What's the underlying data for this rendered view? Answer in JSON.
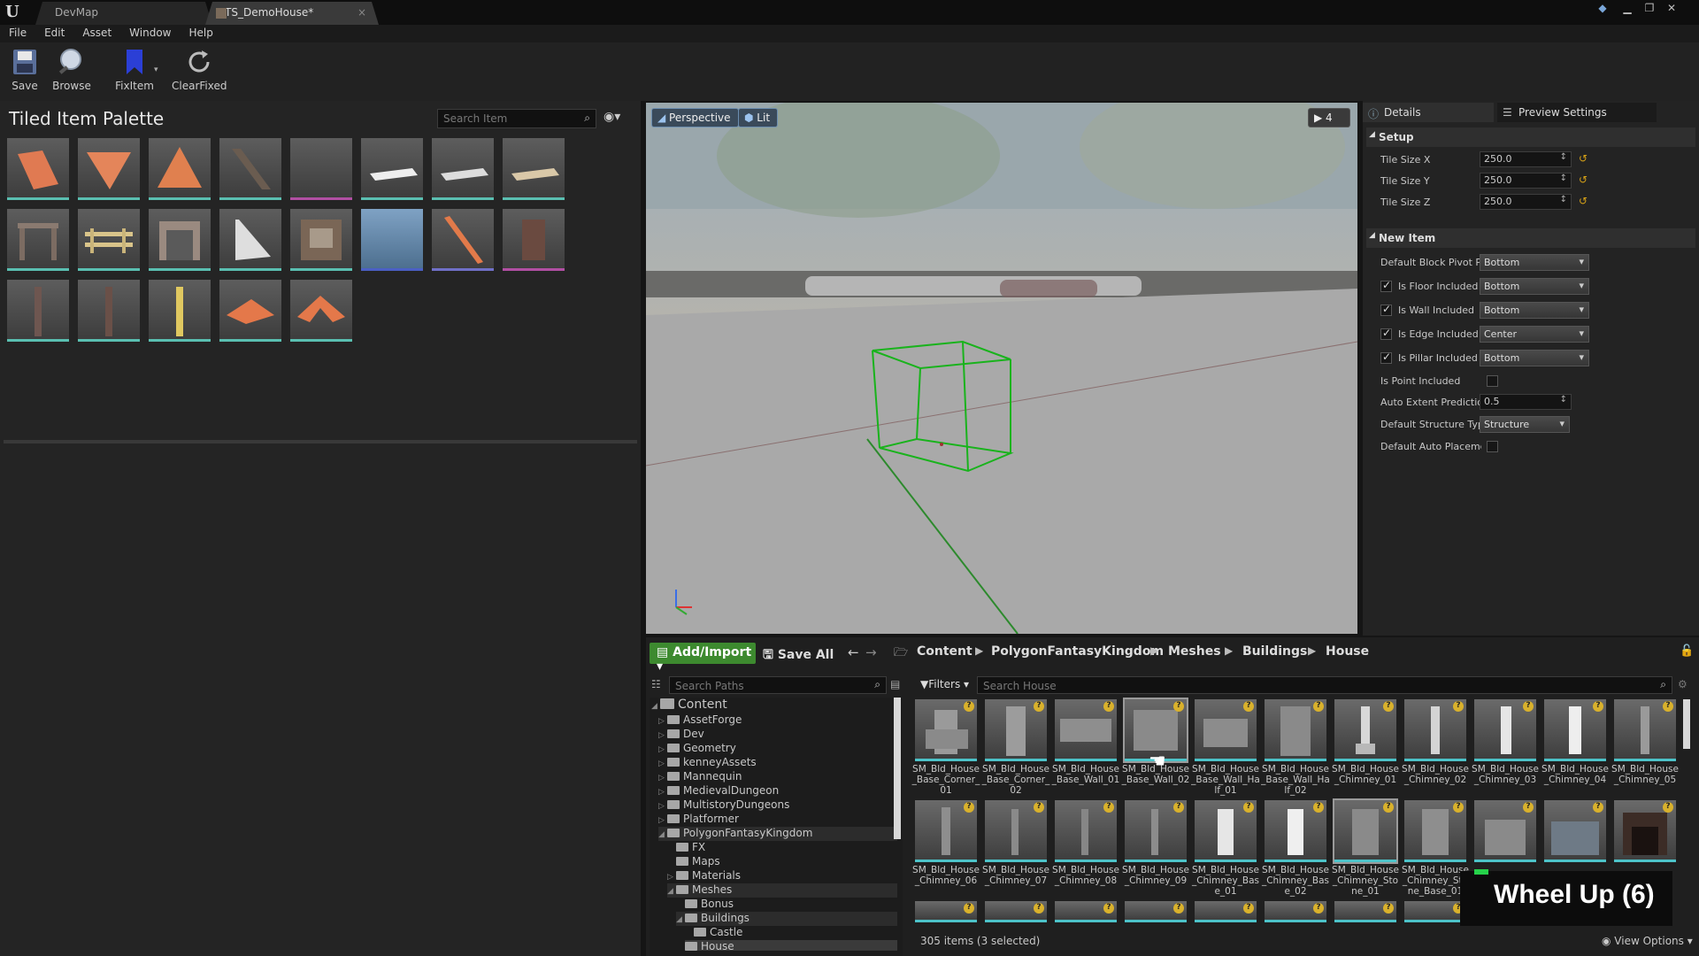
{
  "window": {
    "tabs": [
      {
        "label": "DevMap"
      },
      {
        "label": "TS_DemoHouse*"
      }
    ],
    "controls": [
      "minimize",
      "restore",
      "close"
    ]
  },
  "menu": [
    "File",
    "Edit",
    "Asset",
    "Window",
    "Help"
  ],
  "toolbar": {
    "save": "Save",
    "browse": "Browse",
    "fixitem": "FixItem",
    "clearfixed": "ClearFixed"
  },
  "palette": {
    "title": "Tiled Item Palette",
    "search_placeholder": "Search Item",
    "items_count": 21
  },
  "viewport": {
    "perspective": "Perspective",
    "lit": "Lit",
    "camera_speed": "4"
  },
  "details": {
    "tab_details": "Details",
    "tab_preview": "Preview Settings",
    "setup_label": "Setup",
    "tile_size_x_label": "Tile Size X",
    "tile_size_x": "250.0",
    "tile_size_y_label": "Tile Size Y",
    "tile_size_y": "250.0",
    "tile_size_z_label": "Tile Size Z",
    "tile_size_z": "250.0",
    "new_item_label": "New Item",
    "default_block_pivot_label": "Default Block Pivot P",
    "default_block_pivot": "Bottom",
    "floor_label": "Is Floor Included",
    "floor_value": "Bottom",
    "wall_label": "Is Wall Included",
    "wall_value": "Bottom",
    "edge_label": "Is Edge Included",
    "edge_value": "Center",
    "pillar_label": "Is Pillar Included",
    "pillar_value": "Bottom",
    "point_label": "Is Point Included",
    "auto_extent_label": "Auto Extent Prediction",
    "auto_extent": "0.5",
    "structure_type_label": "Default Structure Typ",
    "structure_type": "Structure",
    "auto_placement_label": "Default Auto Placeme"
  },
  "content_browser": {
    "add_import": "Add/Import",
    "save_all": "Save All",
    "breadcrumb": [
      "Content",
      "PolygonFantasyKingdom",
      "Meshes",
      "Buildings",
      "House"
    ],
    "search_paths_placeholder": "Search Paths",
    "filters": "Filters",
    "search_placeholder": "Search House",
    "status": "305 items (3 selected)",
    "view_options": "View Options",
    "tree": [
      {
        "label": "Content",
        "depth": 0,
        "expanded": true
      },
      {
        "label": "AssetForge",
        "depth": 1
      },
      {
        "label": "Dev",
        "depth": 1
      },
      {
        "label": "Geometry",
        "depth": 1
      },
      {
        "label": "kenneyAssets",
        "depth": 1
      },
      {
        "label": "Mannequin",
        "depth": 1
      },
      {
        "label": "MedievalDungeon",
        "depth": 1
      },
      {
        "label": "MultistoryDungeons",
        "depth": 1
      },
      {
        "label": "Platformer",
        "depth": 1
      },
      {
        "label": "PolygonFantasyKingdom",
        "depth": 1,
        "expanded": true
      },
      {
        "label": "FX",
        "depth": 2
      },
      {
        "label": "Maps",
        "depth": 2
      },
      {
        "label": "Materials",
        "depth": 2
      },
      {
        "label": "Meshes",
        "depth": 2,
        "expanded": true
      },
      {
        "label": "Bonus",
        "depth": 3
      },
      {
        "label": "Buildings",
        "depth": 3,
        "expanded": true
      },
      {
        "label": "Castle",
        "depth": 4
      },
      {
        "label": "House",
        "depth": 4
      }
    ],
    "assets_row1": [
      "SM_Bld_House_Base_Corner_01",
      "SM_Bld_House_Base_Corner_02",
      "SM_Bld_House_Base_Wall_01",
      "SM_Bld_House_Base_Wall_02",
      "SM_Bld_House_Base_Wall_Half_01",
      "SM_Bld_House_Base_Wall_Half_02",
      "SM_Bld_House_Chimney_01",
      "SM_Bld_House_Chimney_02",
      "SM_Bld_House_Chimney_03",
      "SM_Bld_House_Chimney_04",
      "SM_Bld_House_Chimney_05"
    ],
    "assets_row2": [
      "SM_Bld_House_Chimney_06",
      "SM_Bld_House_Chimney_07",
      "SM_Bld_House_Chimney_08",
      "SM_Bld_House_Chimney_09",
      "SM_Bld_House_Chimney_Base_01",
      "SM_Bld_House_Chimney_Base_02",
      "SM_Bld_House_Chimney_Stone_01",
      "SM_Bld_House_Chimney_Stone_Base_01",
      "",
      "",
      ""
    ]
  },
  "overlay": {
    "key_hint": "Wheel Up (6)"
  }
}
